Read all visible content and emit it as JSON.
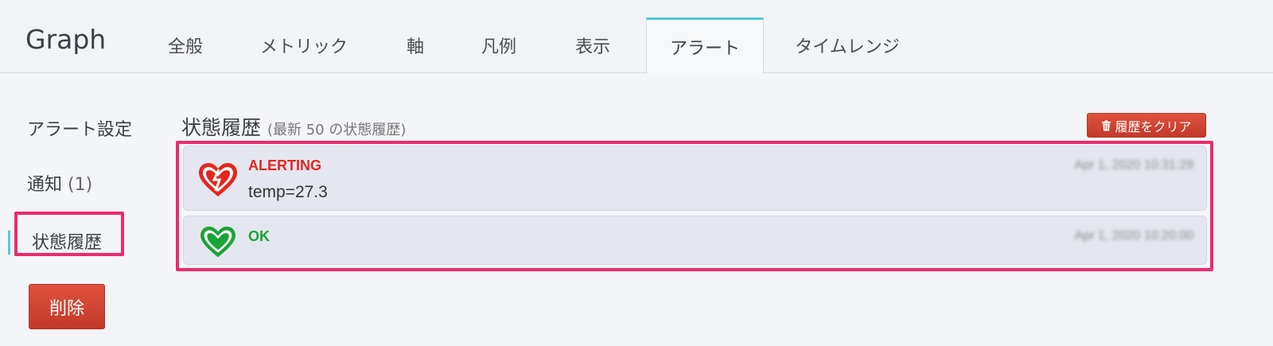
{
  "header": {
    "title": "Graph",
    "tabs": [
      {
        "label": "全般"
      },
      {
        "label": "メトリック"
      },
      {
        "label": "軸"
      },
      {
        "label": "凡例"
      },
      {
        "label": "表示"
      },
      {
        "label": "アラート",
        "active": true
      },
      {
        "label": "タイムレンジ"
      }
    ]
  },
  "sidebar": {
    "items": [
      {
        "label": "アラート設定"
      },
      {
        "label": "通知",
        "count": "(1)"
      },
      {
        "label": "状態履歴",
        "active": true
      }
    ],
    "delete_label": "削除"
  },
  "main": {
    "title": "状態履歴",
    "subtitle": "(最新 50 の状態履歴)",
    "clear_label": "履歴をクリア",
    "entries": [
      {
        "state": "ALERTING",
        "info": "temp=27.3",
        "time": "Apr 1, 2020 10:31:29",
        "color": "#e5261f",
        "icon": "broken-heart-icon"
      },
      {
        "state": "OK",
        "info": "",
        "time": "Apr 1, 2020 10:20:00",
        "color": "#1aa336",
        "icon": "heart-icon"
      }
    ]
  },
  "colors": {
    "accent": "#52c9d5",
    "highlight": "#ee2a6b",
    "danger": "#d04432"
  }
}
